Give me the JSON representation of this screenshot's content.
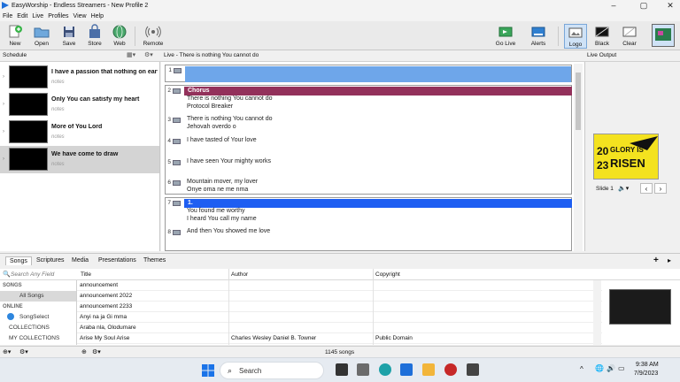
{
  "window": {
    "title": "EasyWorship - Endless Streamers - New Profile 2",
    "controls": [
      "–",
      "▢",
      "✕"
    ]
  },
  "menu": [
    "File",
    "Edit",
    "Live",
    "Profiles",
    "View",
    "Help"
  ],
  "toolbar": {
    "left": [
      {
        "id": "new",
        "label": "New"
      },
      {
        "id": "open",
        "label": "Open"
      },
      {
        "id": "save",
        "label": "Save"
      },
      {
        "id": "store",
        "label": "Store"
      },
      {
        "id": "web",
        "label": "Web"
      },
      {
        "id": "remote",
        "label": "Remote"
      }
    ],
    "right": [
      {
        "id": "go-live",
        "label": "Go Live"
      },
      {
        "id": "alerts",
        "label": "Alerts"
      },
      {
        "id": "logo",
        "label": "Logo"
      },
      {
        "id": "black",
        "label": "Black"
      },
      {
        "id": "clear",
        "label": "Clear"
      }
    ]
  },
  "schedule": {
    "header": "Schedule",
    "items": [
      {
        "title": "I have a passion that nothing on eart...",
        "notes": "notes"
      },
      {
        "title": "Only You can satisfy my heart",
        "notes": "notes"
      },
      {
        "title": "More of You Lord",
        "notes": "notes"
      },
      {
        "title": "We have come to draw",
        "notes": "notes",
        "selected": true
      }
    ]
  },
  "live": {
    "header": "Live - There is nothing You cannot do",
    "slides": [
      {
        "num": "1",
        "label": "",
        "color": "#6ea6ea",
        "lines": []
      },
      {
        "num": "2",
        "label": "Chorus",
        "color": "#93315b",
        "lines": [
          "There is nothing You cannot do",
          "Protocol Breaker"
        ]
      },
      {
        "num": "3",
        "label": "",
        "lines": [
          "There is nothing You cannot do",
          "Jehovah overdo o"
        ]
      },
      {
        "num": "4",
        "label": "",
        "lines": [
          "I have tasted of Your love"
        ]
      },
      {
        "num": "5",
        "label": "",
        "lines": [
          "I have seen Your mighty works"
        ]
      },
      {
        "num": "6",
        "label": "",
        "lines": [
          "Mountain mover, my lover",
          "Onye oma ne me nma"
        ]
      },
      {
        "num": "7",
        "label": "1.",
        "color": "#1e5ef2",
        "lines": [
          "You found me worthy",
          "I heard You call my name"
        ]
      },
      {
        "num": "8",
        "label": "",
        "lines": [
          "And then You showed me love"
        ]
      }
    ]
  },
  "live_output": {
    "header": "Live Output",
    "logo_line1": "GLORY IS",
    "logo_line2": "RISEN",
    "logo_number": "20",
    "logo_number2": "23",
    "slide_label": "Slide 1"
  },
  "tabs": [
    "Songs",
    "Scriptures",
    "Media",
    "Presentations",
    "Themes"
  ],
  "library": {
    "search_placeholder": "Search Any Field",
    "columns": [
      "Title",
      "Author",
      "Copyright"
    ],
    "categories": [
      {
        "label": "SONGS",
        "type": "header"
      },
      {
        "label": "All Songs",
        "type": "item",
        "selected": true
      },
      {
        "label": "ONLINE",
        "type": "header"
      },
      {
        "label": "SongSelect",
        "type": "item"
      },
      {
        "label": "COLLECTIONS",
        "type": "group"
      },
      {
        "label": "MY COLLECTIONS",
        "type": "group"
      }
    ],
    "rows": [
      {
        "title": "announcement",
        "author": "",
        "copyright": ""
      },
      {
        "title": "announcement 2022",
        "author": "",
        "copyright": ""
      },
      {
        "title": "announcement 2233",
        "author": "",
        "copyright": ""
      },
      {
        "title": "Anyi na ja Gi mma",
        "author": "",
        "copyright": ""
      },
      {
        "title": "Araba nla, Olodumare",
        "author": "",
        "copyright": ""
      },
      {
        "title": "Arise My Soul Arise",
        "author": "Charles Wesley Daniel B. Towner",
        "copyright": "Public Domain"
      }
    ],
    "count": "1145 songs"
  },
  "taskbar": {
    "search": "Search",
    "time": "9:38 AM",
    "date": "7/9/2023"
  },
  "colors": {
    "chorus": "#93315b",
    "verse": "#1e5ef2",
    "blank": "#6ea6ea",
    "accent": "#1a73e8"
  }
}
